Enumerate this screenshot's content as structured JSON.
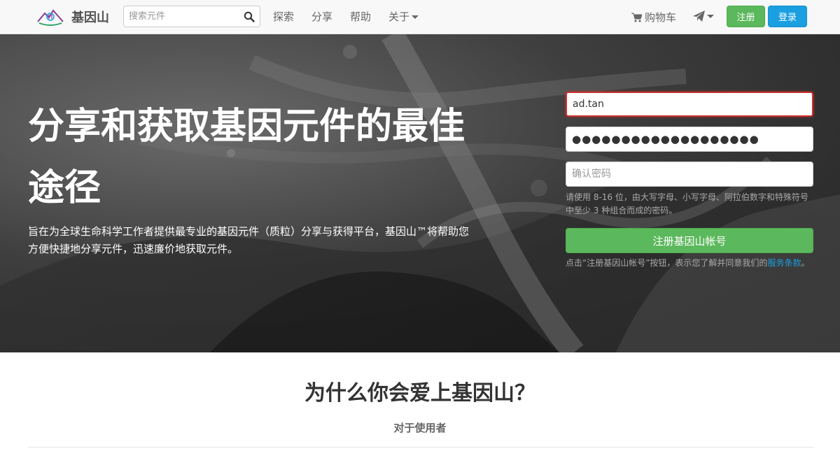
{
  "nav": {
    "brand": "基因山",
    "search_placeholder": "搜索元件",
    "links": [
      "探索",
      "分享",
      "帮助",
      "关于"
    ],
    "cart": "购物车",
    "register": "注册",
    "login": "登录"
  },
  "hero": {
    "title": "分享和获取基因元件的最佳途径",
    "description": "旨在为全球生命科学工作者提供最专业的基因元件（质粒）分享与获得平台，基因山™将帮助您方便快捷地分享元件，迅速廉价地获取元件。"
  },
  "form": {
    "username_value": "ad.tan",
    "password_dots": "●●●●●●●●●●●●●●●●●●●",
    "confirm_placeholder": "确认密码",
    "password_hint": "请使用 8-16 位，由大写字母、小写字母、阿拉伯数字和特殊符号中至少 3 种组合而成的密码。",
    "submit": "注册基因山帐号",
    "terms_prefix": "点击“注册基因山帐号”按钮，表示您了解并同意我们的",
    "terms_link": "服务条款",
    "terms_suffix": "。"
  },
  "why": {
    "title": "为什么你会爱上基因山？",
    "subtitle": "对于使用者"
  },
  "colors": {
    "success": "#5cb85c",
    "primary": "#1a9fe0",
    "error": "#c9302c"
  }
}
